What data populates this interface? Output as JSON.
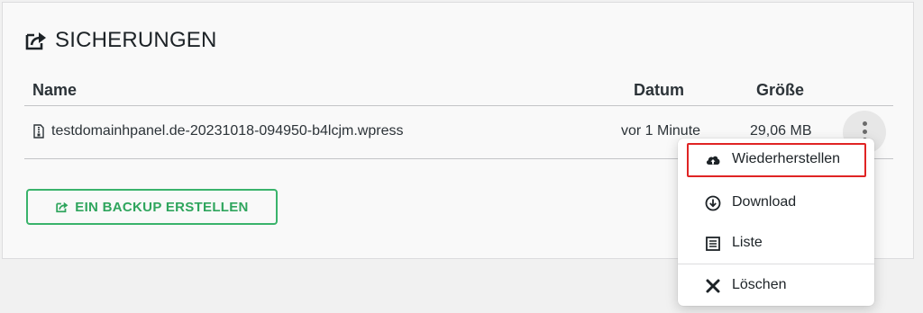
{
  "section": {
    "title": "SICHERUNGEN"
  },
  "table": {
    "headers": {
      "name": "Name",
      "date": "Datum",
      "size": "Größe"
    },
    "rows": [
      {
        "name": "testdomainhpanel.de-20231018-094950-b4lcjm.wpress",
        "date": "vor 1 Minute",
        "size": "29,06 MB"
      }
    ]
  },
  "actions": {
    "create_backup": "EIN BACKUP ERSTELLEN"
  },
  "dropdown": {
    "items": [
      {
        "label": "Wiederherstellen",
        "icon": "cloud-upload-icon",
        "highlighted": true
      },
      {
        "label": "Download",
        "icon": "download-circle-icon"
      },
      {
        "label": "Liste",
        "icon": "list-icon"
      },
      {
        "label": "Löschen",
        "icon": "close-icon"
      }
    ]
  },
  "colors": {
    "accent_green": "#2fa55d",
    "highlight_red": "#e02424"
  }
}
